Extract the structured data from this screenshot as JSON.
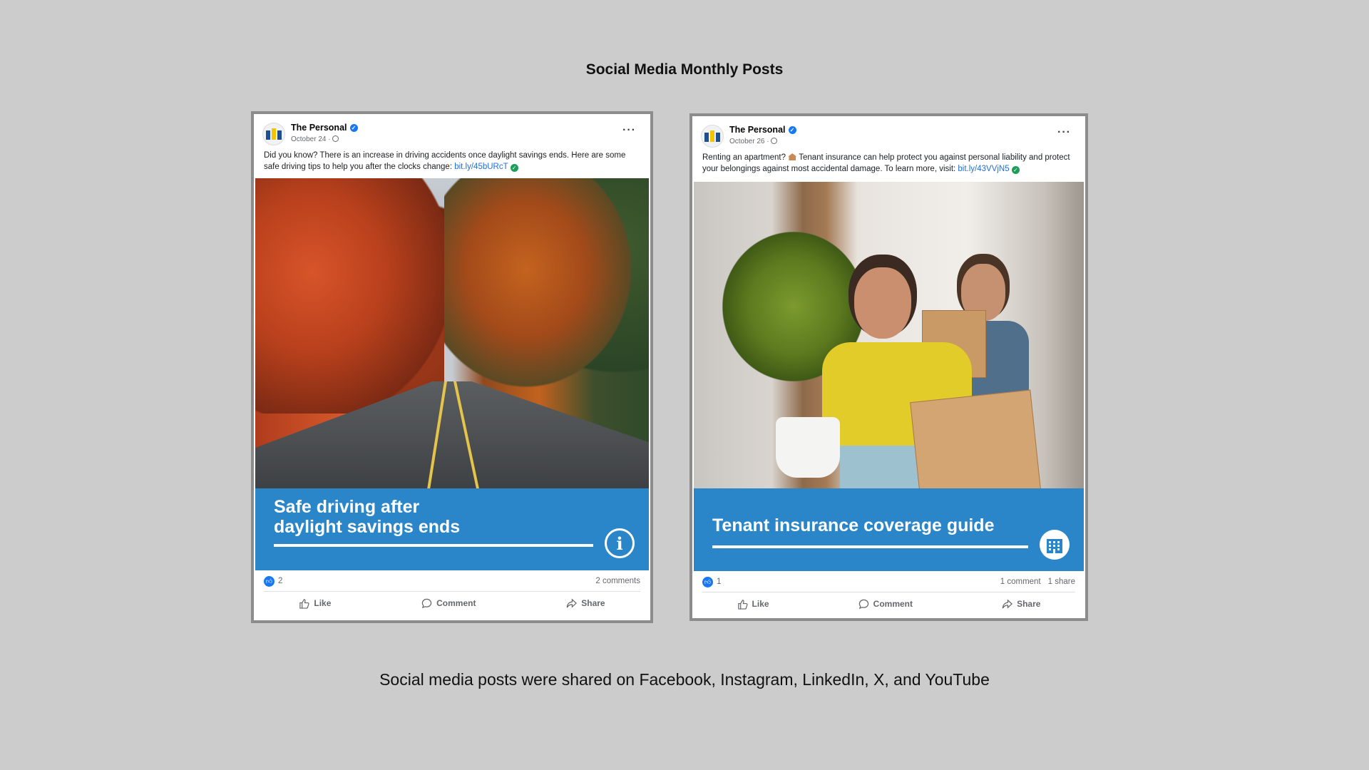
{
  "page": {
    "title": "Social Media Monthly Posts",
    "caption": "Social media posts were shared on Facebook, Instagram, LinkedIn, X, and YouTube"
  },
  "posts": [
    {
      "page_name": "The Personal",
      "date": "October 24 ·",
      "more": "···",
      "text_before_link": "Did you know? There is an increase in driving accidents once daylight savings ends. Here are some safe driving tips to help you after the clocks change: ",
      "link": "bit.ly/45bURcT",
      "banner_title": "Safe driving after\ndaylight savings ends",
      "banner_icon": "info-icon",
      "reactions": "2",
      "comments": "2 comments",
      "shares": "",
      "actions": {
        "like": "Like",
        "comment": "Comment",
        "share": "Share"
      }
    },
    {
      "page_name": "The Personal",
      "date": "October 26 ·",
      "more": "···",
      "text_intro": "Renting an apartment? ",
      "text_before_link": " Tenant insurance can help protect you against personal liability and protect your belongings against most accidental damage. To learn more, visit: ",
      "link": "bit.ly/43VVjN5",
      "banner_title": "Tenant insurance coverage guide",
      "banner_icon": "building-icon",
      "reactions": "1",
      "comments": "1 comment",
      "shares": "1 share",
      "actions": {
        "like": "Like",
        "comment": "Comment",
        "share": "Share"
      }
    }
  ],
  "colors": {
    "background": "#cccccc",
    "banner": "#2a86c8",
    "facebook_blue": "#1877f2",
    "link": "#216fdb"
  }
}
